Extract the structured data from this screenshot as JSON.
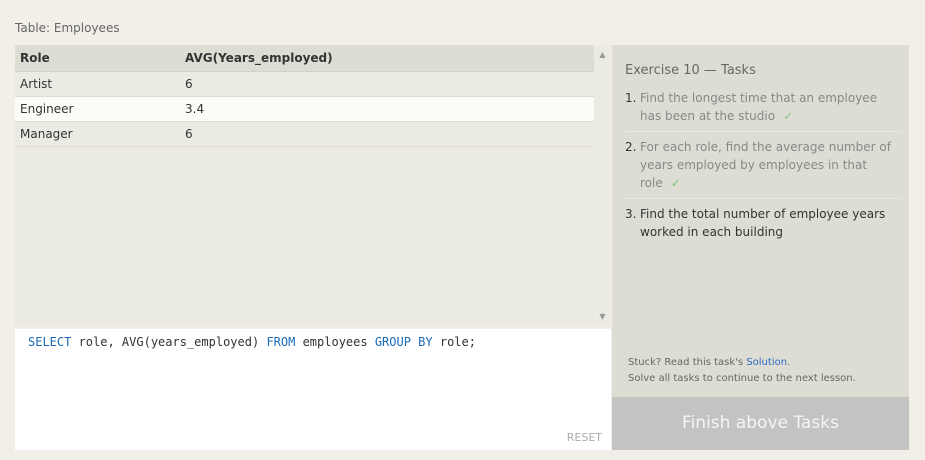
{
  "caption": "Table: Employees",
  "results": {
    "columns": [
      "Role",
      "AVG(Years_employed)"
    ],
    "rows": [
      [
        "Artist",
        "6"
      ],
      [
        "Engineer",
        "3.4"
      ],
      [
        "Manager",
        "6"
      ]
    ]
  },
  "editor": {
    "query_parts": [
      "SELECT",
      " role, AVG(years_employed) ",
      "FROM",
      " employees ",
      "GROUP BY",
      " role;"
    ],
    "reset_label": "RESET"
  },
  "tasks_panel": {
    "title": "Exercise 10 — Tasks",
    "tasks": [
      {
        "num": "1.",
        "text": "Find the longest time that an employee has been at the studio",
        "check": "✓"
      },
      {
        "num": "2.",
        "text": "For each role, find the average number of years employed by employees in that role",
        "check": "✓"
      },
      {
        "num": "3.",
        "text": "Find the total number of employee years worked in each building"
      }
    ],
    "hint_prefix": "Stuck? Read this task's ",
    "hint_link": "Solution",
    "hint_suffix": ".",
    "hint_line2": "Solve all tasks to continue to the next lesson.",
    "finish_label": "Finish above Tasks"
  },
  "colors": {
    "keyword": "#1c6ab7",
    "check": "#86c480",
    "link": "#2b6bc4",
    "finish_button": "#c3c3c1"
  }
}
